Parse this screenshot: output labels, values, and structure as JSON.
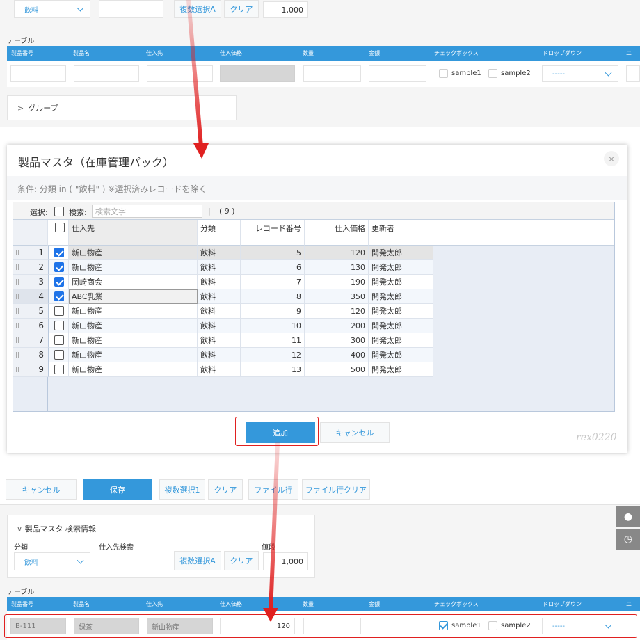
{
  "top": {
    "category_value": "飲料",
    "multi_select_button": "複数選択A",
    "clear_button": "クリア",
    "amount_value": "1,000",
    "table_label": "テーブル",
    "columns": [
      "製品番号",
      "製品名",
      "仕入先",
      "仕入価格",
      "数量",
      "金額",
      "チェックボックス",
      "ドロップダウン",
      "ユ"
    ],
    "checkbox_options": [
      "sample1",
      "sample2"
    ],
    "dropdown_value": "-----",
    "group_label": "グループ"
  },
  "dialog": {
    "title": "製品マスタ（在庫管理パック）",
    "close": "×",
    "condition": "条件: 分類 in ( \"飲料\" )  ※選択済みレコードを除く",
    "select_label": "選択:",
    "search_label": "検索:",
    "search_placeholder": "検索文字",
    "separator": "|",
    "count": "( 9 )",
    "headers": {
      "supplier": "仕入先",
      "category": "分類",
      "record_no": "レコード番号",
      "price": "仕入価格",
      "updater": "更新者"
    },
    "rows": [
      {
        "no": "1",
        "checked": true,
        "supplier": "新山物産",
        "category": "飲料",
        "record_no": "5",
        "price": "120",
        "updater": "開発太郎"
      },
      {
        "no": "2",
        "checked": true,
        "supplier": "新山物産",
        "category": "飲料",
        "record_no": "6",
        "price": "130",
        "updater": "開発太郎"
      },
      {
        "no": "3",
        "checked": true,
        "supplier": "岡崎商会",
        "category": "飲料",
        "record_no": "7",
        "price": "190",
        "updater": "開発太郎"
      },
      {
        "no": "4",
        "checked": true,
        "supplier": "ABC乳業",
        "category": "飲料",
        "record_no": "8",
        "price": "350",
        "updater": "開発太郎"
      },
      {
        "no": "5",
        "checked": false,
        "supplier": "新山物産",
        "category": "飲料",
        "record_no": "9",
        "price": "120",
        "updater": "開発太郎"
      },
      {
        "no": "6",
        "checked": false,
        "supplier": "新山物産",
        "category": "飲料",
        "record_no": "10",
        "price": "200",
        "updater": "開発太郎"
      },
      {
        "no": "7",
        "checked": false,
        "supplier": "新山物産",
        "category": "飲料",
        "record_no": "11",
        "price": "300",
        "updater": "開発太郎"
      },
      {
        "no": "8",
        "checked": false,
        "supplier": "新山物産",
        "category": "飲料",
        "record_no": "12",
        "price": "400",
        "updater": "開発太郎"
      },
      {
        "no": "9",
        "checked": false,
        "supplier": "新山物産",
        "category": "飲料",
        "record_no": "13",
        "price": "500",
        "updater": "開発太郎"
      }
    ],
    "add_button": "追加",
    "cancel_button": "キャンセル",
    "watermark": "rex0220"
  },
  "bottom": {
    "toolbar": {
      "cancel": "キャンセル",
      "save": "保存",
      "multi1": "複数選択1",
      "clear": "クリア",
      "file_row": "ファイル行",
      "file_row_clear": "ファイル行クリア"
    },
    "search_group": "製品マスタ 検索情報",
    "category_label": "分類",
    "supplier_search_label": "仕入先検索",
    "value_label": "値段",
    "category_value": "飲料",
    "multi_select_button": "複数選択A",
    "clear_button": "クリア",
    "amount_value": "1,000",
    "table_label": "テーブル",
    "columns": [
      "製品番号",
      "製品名",
      "仕入先",
      "仕入価格",
      "数量",
      "金額",
      "チェックボックス",
      "ドロップダウン",
      "ユ"
    ],
    "row": {
      "product_no": "B-111",
      "product_name": "緑茶",
      "supplier": "新山物産",
      "price": "120",
      "checkbox_options": [
        "sample1",
        "sample2"
      ],
      "dropdown_value": "-----"
    }
  },
  "colors": {
    "accent": "#3498db",
    "arrow": "#e02020",
    "check": "#1e73e8"
  }
}
